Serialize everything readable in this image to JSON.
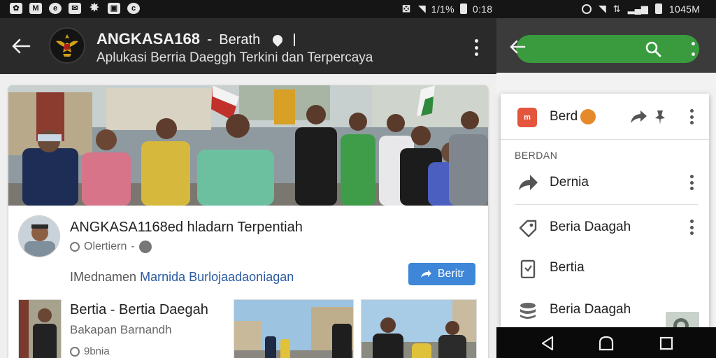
{
  "status_bar": {
    "left_icons": [
      "wechat-icon",
      "gmail-icon",
      "browser-icon",
      "mail-icon",
      "pinwheel-icon",
      "gallery-icon",
      "chrome-icon"
    ],
    "center_text": "1/1%",
    "center_extra": "0:18",
    "right_text": "1045M"
  },
  "app_bar": {
    "title": "ANGKASA168",
    "separator": "-",
    "title_suffix": "Berath",
    "subtitle": "Aplukasi Berria Daeggh Terkini dan Terpercaya"
  },
  "feed": {
    "headline": "ANGKASA1168ed hladarn Terpentiah",
    "meta_text": "Olertiern",
    "meta_sep": "-",
    "author_prefix": "IMednamen",
    "author_link": "Marnida Burlojaadaoniagan",
    "berita_button": "Beritr",
    "sub_title": "Bertia - Bertia Daegah",
    "sub_subtitle": "Bakapan Barnandh",
    "sub_meta": "9bnia"
  },
  "right_panel": {
    "head_label": "Berd",
    "section_label": "BERDAN",
    "items": [
      {
        "label": "Dernia",
        "icon": "forward-arrow-icon"
      },
      {
        "label": "Beria Daagah",
        "icon": "tag-icon"
      },
      {
        "label": "Bertia",
        "icon": "clipboard-icon"
      },
      {
        "label": "Beria Daagah",
        "icon": "stack-icon"
      }
    ]
  },
  "colors": {
    "search_bar": "#3a9b3e",
    "button_blue": "#3d86d8",
    "app_badge": "#e4553d"
  }
}
